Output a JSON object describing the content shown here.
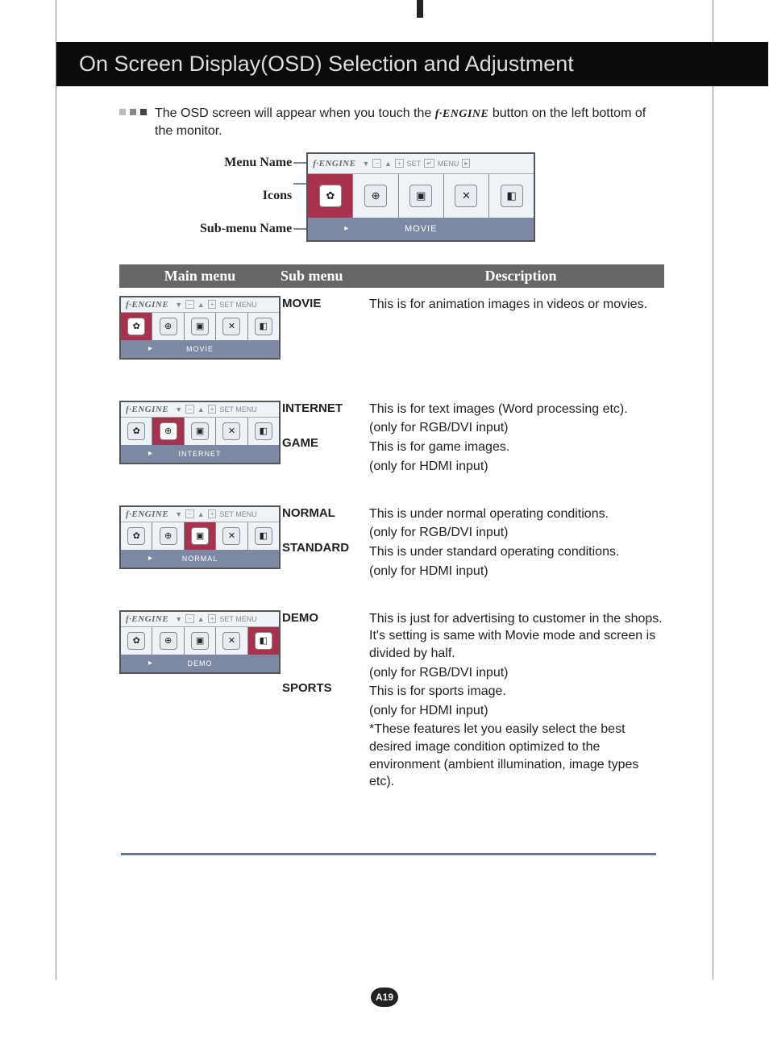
{
  "page_title": "On Screen Display(OSD) Selection and Adjustment",
  "intro_a": "The OSD screen will appear when you touch the ",
  "intro_engine": "f·ENGINE",
  "intro_b": " button on the left bottom of the monitor.",
  "diagram": {
    "label_menu_name": "Menu Name",
    "label_icons": "Icons",
    "label_submenu_name": "Sub-menu Name",
    "engine_logo": "f·ENGINE",
    "submenu": "MOVIE",
    "hdr_set": "SET",
    "hdr_menu": "MENU"
  },
  "table_header": {
    "c1": "Main menu",
    "c2": "Sub menu",
    "c3": "Description"
  },
  "rows": [
    {
      "thumb_sub": "MOVIE",
      "sel": 0,
      "subs": [
        "MOVIE"
      ],
      "desc": [
        "This is for animation images in videos or movies."
      ]
    },
    {
      "thumb_sub": "INTERNET",
      "sel": 1,
      "subs": [
        "INTERNET",
        "GAME"
      ],
      "desc": [
        "This is for text images (Word processing etc).",
        "(only for RGB/DVI input)",
        "This is for game images.",
        "(only for HDMI input)"
      ]
    },
    {
      "thumb_sub": "NORMAL",
      "sel": 2,
      "subs": [
        "NORMAL",
        "STANDARD"
      ],
      "desc": [
        "This is under normal operating conditions.",
        "(only for RGB/DVI input)",
        "This is under standard operating conditions.",
        "(only for HDMI input)"
      ]
    },
    {
      "thumb_sub": "DEMO",
      "sel": 3,
      "subs": [
        "DEMO",
        "SPORTS"
      ],
      "desc": [
        "This is just for advertising to customer in the shops. It's setting is same with Movie mode and screen is divided by half.",
        "(only for RGB/DVI input)",
        "This is for sports image.",
        "(only for HDMI input)"
      ],
      "star": "*These features let you easily select the best desired image condition optimized to the environment (ambient illumination, image types etc)."
    }
  ],
  "page_number": "A19"
}
